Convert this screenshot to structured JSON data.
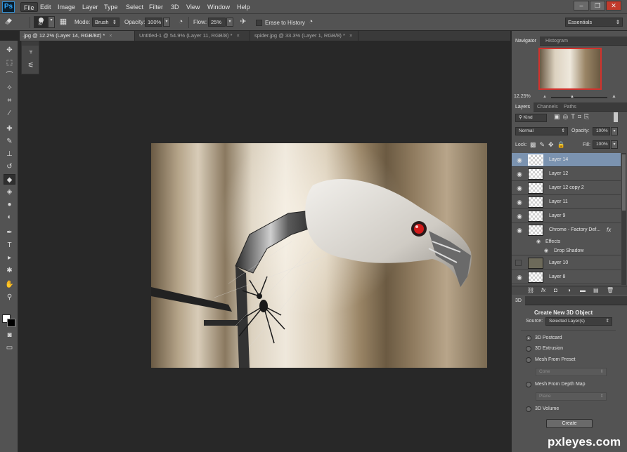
{
  "app": {
    "logo": "Ps"
  },
  "menu": [
    "File",
    "Edit",
    "Image",
    "Layer",
    "Type",
    "Select",
    "Filter",
    "3D",
    "View",
    "Window",
    "Help"
  ],
  "window_controls": {
    "minimize": "–",
    "restore": "❐",
    "close": "✕"
  },
  "options_bar": {
    "brush_size": "87",
    "mode_label": "Mode:",
    "mode_value": "Brush",
    "opacity_label": "Opacity:",
    "opacity_value": "100%",
    "flow_label": "Flow:",
    "flow_value": "25%",
    "erase_to_history_label": "Erase to History",
    "workspace": "Essentials"
  },
  "doc_tabs": [
    {
      "label": ".jpg @ 12.2% (Layer 14, RGB/8#) *",
      "close": "×",
      "active": true
    },
    {
      "label": "Untitled-1 @ 54.9% (Layer 11, RGB/8) *",
      "close": "×",
      "active": false
    },
    {
      "label": "spider.jpg @ 33.3% (Layer 1, RGB/8) *",
      "close": "×",
      "active": false
    }
  ],
  "navigator": {
    "tabs": [
      "Navigator",
      "Histogram"
    ],
    "zoom": "12.25%"
  },
  "layers_panel": {
    "tabs": [
      "Layers",
      "Channels",
      "Paths"
    ],
    "kind_label": "Kind",
    "blend_mode": "Normal",
    "opacity_label": "Opacity:",
    "opacity_value": "100%",
    "lock_label": "Lock:",
    "fill_label": "Fill:",
    "fill_value": "100%",
    "layers": [
      {
        "name": "Layer 14",
        "selected": true,
        "visible": true
      },
      {
        "name": "Layer 12",
        "selected": false,
        "visible": true
      },
      {
        "name": "Layer 12 copy 2",
        "selected": false,
        "visible": true
      },
      {
        "name": "Layer 11",
        "selected": false,
        "visible": true
      },
      {
        "name": "Layer 9",
        "selected": false,
        "visible": true
      },
      {
        "name": "Chrome - Factory Def...",
        "selected": false,
        "visible": true,
        "fx": "fx"
      },
      {
        "name": "Layer 10",
        "selected": false,
        "visible": false
      },
      {
        "name": "Layer 8",
        "selected": false,
        "visible": true
      }
    ],
    "effects_label": "Effects",
    "drop_shadow_label": "Drop Shadow",
    "footer_icons": [
      "link-icon",
      "fx-icon",
      "mask-icon",
      "adjustment-icon",
      "group-icon",
      "new-layer-icon",
      "trash-icon"
    ],
    "fx_glyph": "fx"
  },
  "panel_3d": {
    "tab": "3D",
    "title": "Create New 3D Object",
    "source_label": "Source:",
    "source_value": "Selected Layer(s)",
    "options": [
      {
        "label": "3D Postcard",
        "selected": true
      },
      {
        "label": "3D Extrusion",
        "selected": false
      },
      {
        "label": "Mesh From Preset",
        "selected": false
      },
      {
        "label": "Mesh From Depth Map",
        "selected": false
      },
      {
        "label": "3D Volume",
        "selected": false
      }
    ],
    "preset_value": "Cone",
    "depth_map_value": "Plane",
    "create_label": "Create"
  },
  "watermark": "pxleyes.com"
}
